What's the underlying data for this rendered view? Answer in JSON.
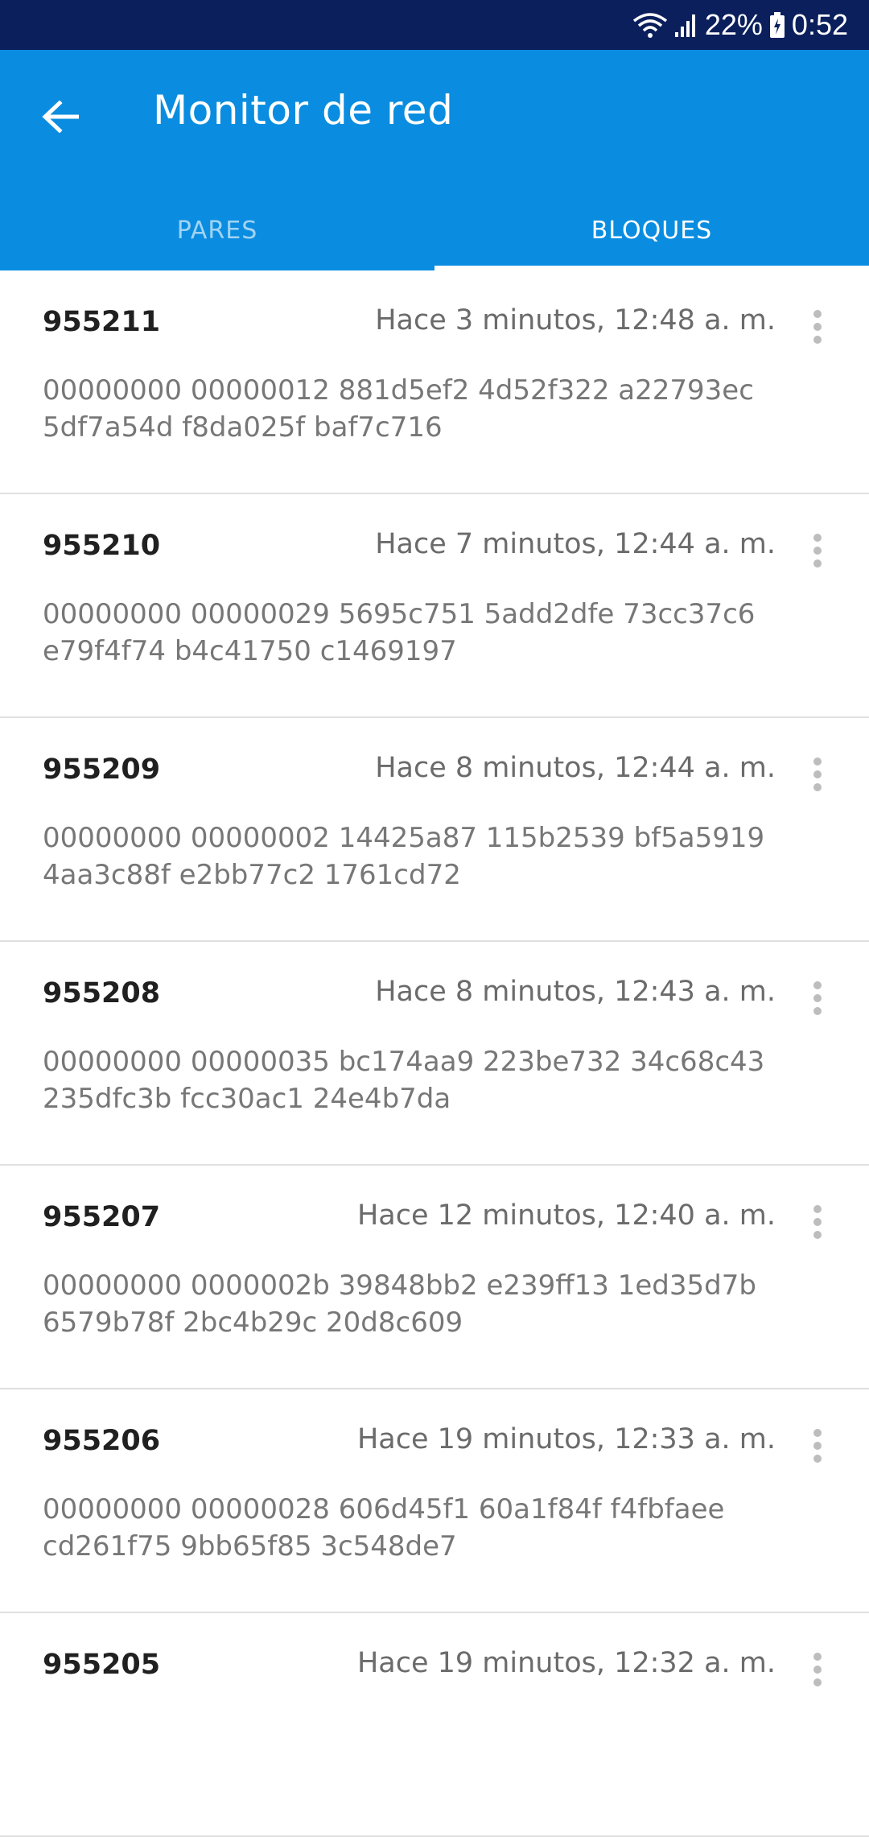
{
  "status_bar": {
    "battery": "22%",
    "time": "0:52"
  },
  "app_bar": {
    "title": "Monitor de red",
    "back_icon": "arrow-left-icon"
  },
  "tabs": [
    {
      "label": "PARES",
      "active": false
    },
    {
      "label": "BLOQUES",
      "active": true
    }
  ],
  "blocks": [
    {
      "number": "955211",
      "time": "Hace 3 minutos, 12:48 a. m.",
      "hash": "00000000 00000012 881d5ef2 4d52f322 a22793ec 5df7a54d f8da025f baf7c716"
    },
    {
      "number": "955210",
      "time": "Hace 7 minutos, 12:44 a. m.",
      "hash": "00000000 00000029 5695c751 5add2dfe 73cc37c6 e79f4f74 b4c41750 c1469197"
    },
    {
      "number": "955209",
      "time": "Hace 8 minutos, 12:44 a. m.",
      "hash": "00000000 00000002 14425a87 115b2539 bf5a5919 4aa3c88f e2bb77c2 1761cd72"
    },
    {
      "number": "955208",
      "time": "Hace 8 minutos, 12:43 a. m.",
      "hash": "00000000 00000035 bc174aa9 223be732 34c68c43 235dfc3b fcc30ac1 24e4b7da"
    },
    {
      "number": "955207",
      "time": "Hace 12 minutos, 12:40 a. m.",
      "hash": "00000000 0000002b 39848bb2 e239ff13 1ed35d7b 6579b78f 2bc4b29c 20d8c609"
    },
    {
      "number": "955206",
      "time": "Hace 19 minutos, 12:33 a. m.",
      "hash": "00000000 00000028 606d45f1 60a1f84f f4fbfaee cd261f75 9bb65f85 3c548de7"
    },
    {
      "number": "955205",
      "time": "Hace 19 minutos, 12:32 a. m.",
      "hash": ""
    }
  ],
  "colors": {
    "status_bar": "#0a1f5c",
    "app_bar": "#0a8de0",
    "text_primary": "#202020",
    "text_secondary": "#6b6b6b"
  }
}
